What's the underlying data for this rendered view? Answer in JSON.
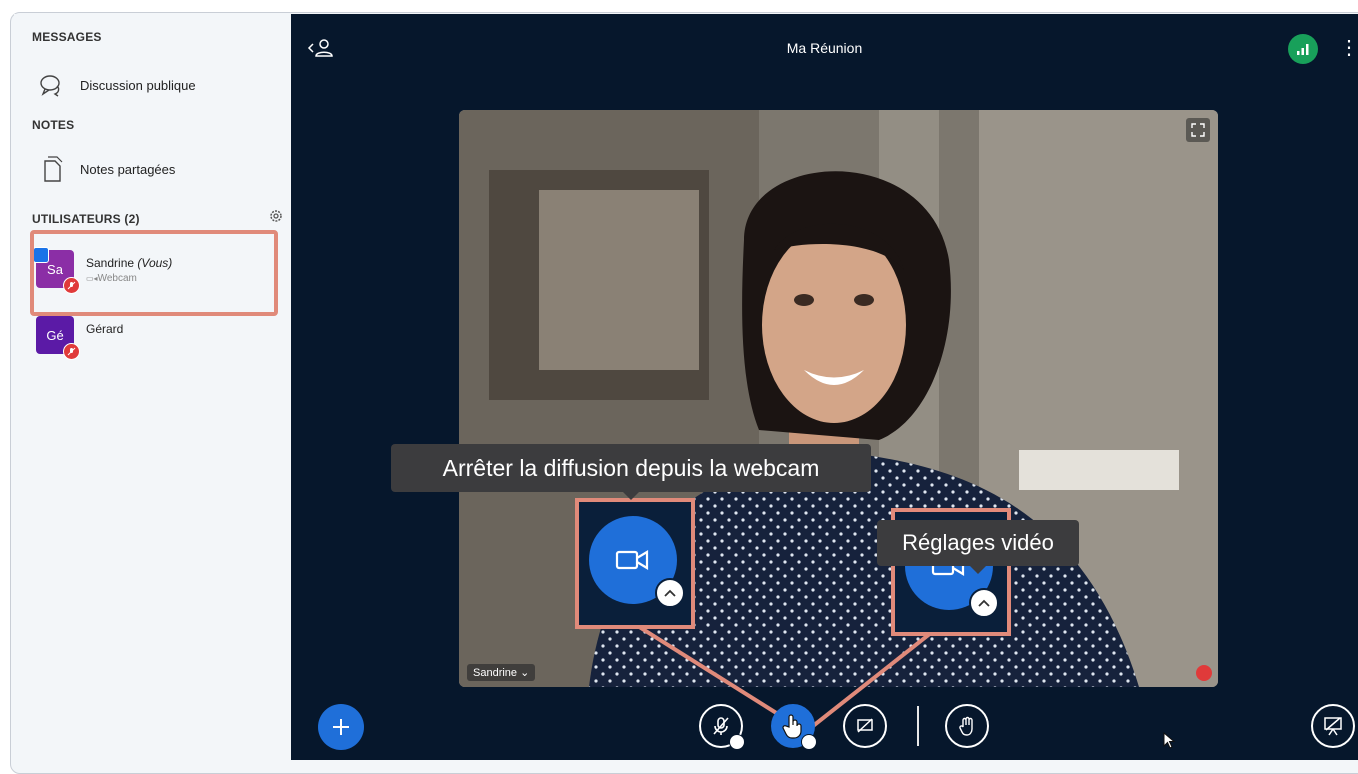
{
  "sidebar": {
    "messages_title": "MESSAGES",
    "public_chat": "Discussion publique",
    "notes_title": "NOTES",
    "shared_notes": "Notes partagées",
    "users_title": "UTILISATEURS (2)",
    "users": [
      {
        "initials": "Sa",
        "name": "Sandrine",
        "you": "(Vous)",
        "status": "Webcam"
      },
      {
        "initials": "Gé",
        "name": "Gérard"
      }
    ]
  },
  "meeting": {
    "title": "Ma Réunion",
    "video_name": "Sandrine"
  },
  "tooltips": {
    "stop_webcam": "Arrêter la diffusion depuis la webcam",
    "video_settings": "Réglages vidéo"
  },
  "icons": [
    "chat-icon",
    "notes-icon",
    "gear-icon",
    "user-list-icon",
    "signal-icon",
    "kebab-menu-icon",
    "fullscreen-icon",
    "microphone-muted-icon",
    "camera-icon",
    "screenshare-icon",
    "raise-hand-icon",
    "plus-icon",
    "presentation-icon"
  ],
  "colors": {
    "accent": "#1f6fd9",
    "background": "#06172c",
    "annotation": "#e08a7a",
    "muted": "#e03a3a",
    "signal": "#18a05a"
  }
}
